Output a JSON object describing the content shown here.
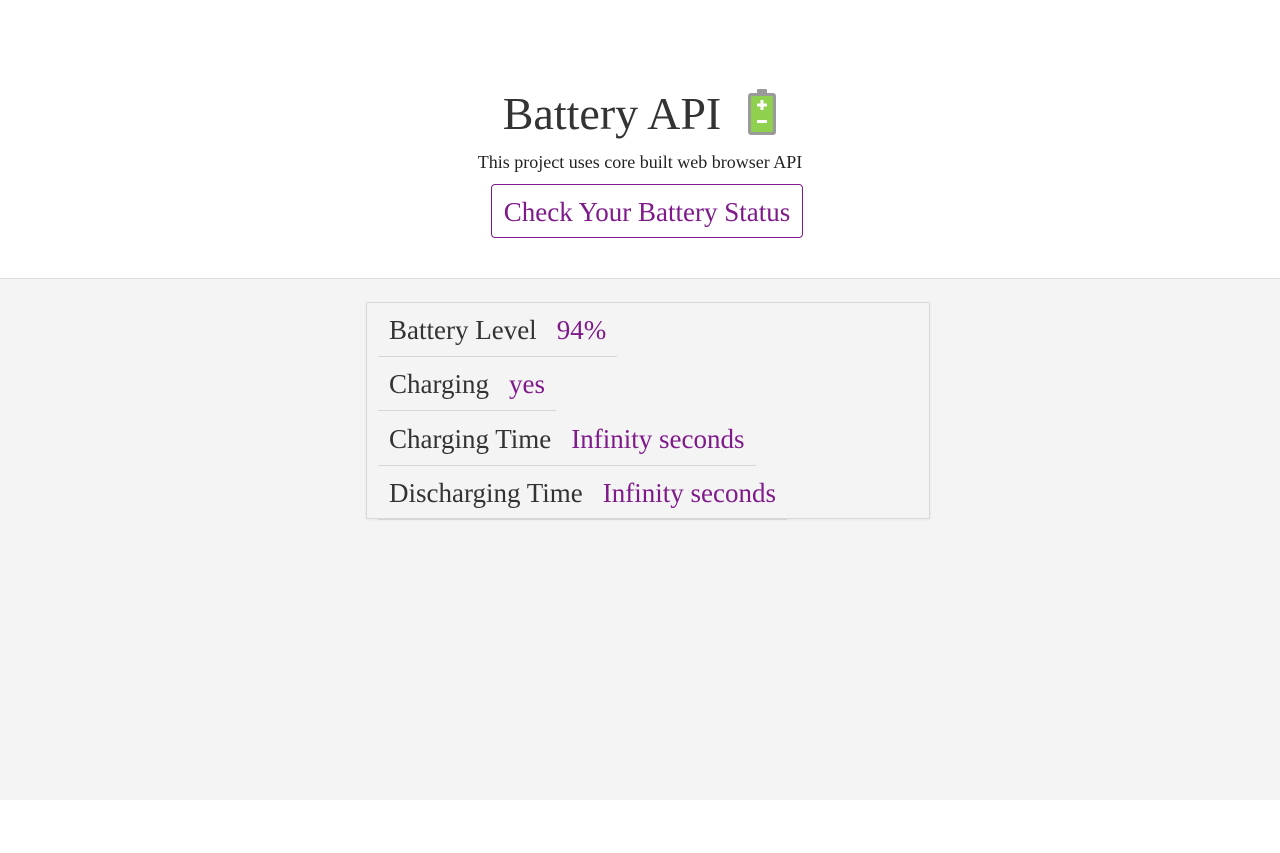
{
  "header": {
    "title": "Battery API",
    "icon": "battery-charging-icon",
    "subtitle": "This project uses core built web browser API",
    "check_button_label": "Check Your Battery Status"
  },
  "status": {
    "rows": [
      {
        "label": "Battery Level",
        "value": "94%"
      },
      {
        "label": "Charging",
        "value": "yes"
      },
      {
        "label": "Charging Time",
        "value": "Infinity seconds"
      },
      {
        "label": "Discharging Time",
        "value": "Infinity seconds"
      }
    ]
  },
  "colors": {
    "accent": "#7e1a8a",
    "text": "#333333",
    "battery_body": "#8fd14f",
    "battery_cap": "#9a9a9a",
    "panel_background": "#f4f4f4"
  }
}
